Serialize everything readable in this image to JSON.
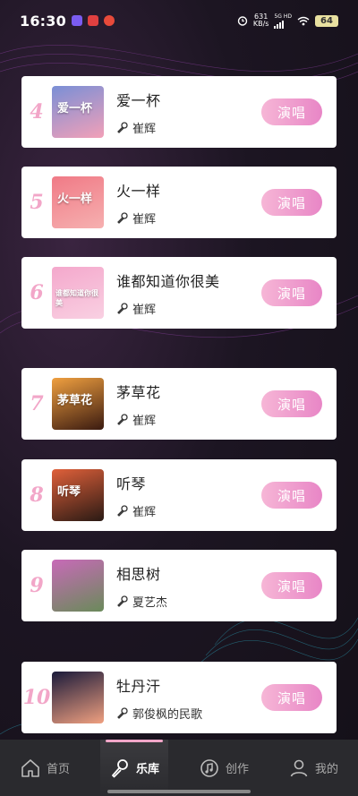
{
  "status_bar": {
    "time": "16:30",
    "net_speed_value": "631",
    "net_speed_unit": "KB/s",
    "signal_label_top": "5G HD",
    "battery": "64"
  },
  "songs": [
    {
      "rank": "4",
      "title": "爱一杯",
      "artist": "崔辉",
      "cover_text": "爱一杯",
      "cover_colors": [
        "#7a8fd6",
        "#f2a0b8"
      ],
      "button": "演唱"
    },
    {
      "rank": "5",
      "title": "火一样",
      "artist": "崔辉",
      "cover_text": "火一样",
      "cover_colors": [
        "#f07a86",
        "#f6b0b0"
      ],
      "button": "演唱"
    },
    {
      "rank": "6",
      "title": "谁都知道你很美",
      "artist": "崔辉",
      "cover_text": "谁都知道你很美",
      "cover_colors": [
        "#f4a8cc",
        "#f9d0e2"
      ],
      "button": "演唱"
    },
    {
      "rank": "7",
      "title": "茅草花",
      "artist": "崔辉",
      "cover_text": "茅草花",
      "cover_colors": [
        "#f0a040",
        "#3a1a10"
      ],
      "button": "演唱"
    },
    {
      "rank": "8",
      "title": "听琴",
      "artist": "崔辉",
      "cover_text": "听琴",
      "cover_colors": [
        "#e0603a",
        "#2a1a14"
      ],
      "button": "演唱"
    },
    {
      "rank": "9",
      "title": "相思树",
      "artist": "夏艺杰",
      "cover_text": "",
      "cover_colors": [
        "#c86ab8",
        "#6a8a5a"
      ],
      "button": "演唱"
    },
    {
      "rank": "10",
      "title": "牡丹汗",
      "artist": "郭俊枫的民歌",
      "cover_text": "",
      "cover_colors": [
        "#1a1a3a",
        "#f0a080"
      ],
      "button": "演唱"
    }
  ],
  "bottom_nav": [
    {
      "label": "首页",
      "icon": "home-icon",
      "active": false
    },
    {
      "label": "乐库",
      "icon": "microphone-icon",
      "active": true
    },
    {
      "label": "创作",
      "icon": "music-note-icon",
      "active": false
    },
    {
      "label": "我的",
      "icon": "user-icon",
      "active": false
    }
  ],
  "colors": {
    "accent_pink": "#e886c6",
    "rank_pink": "#f2a6c8",
    "nav_bg": "#2a2a2e"
  }
}
